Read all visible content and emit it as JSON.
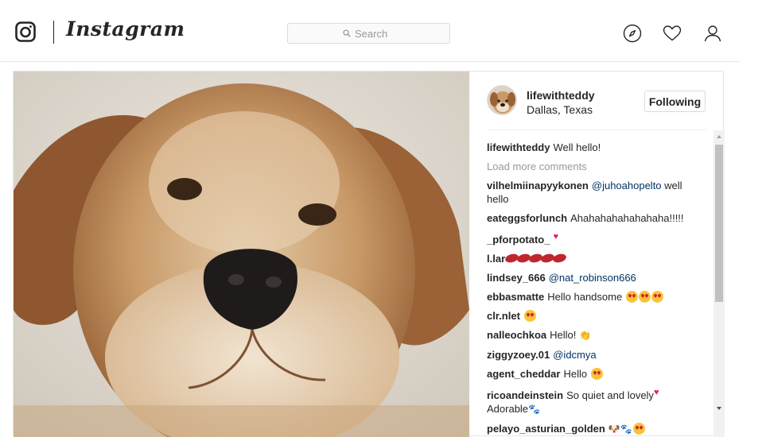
{
  "header": {
    "logo_icon": "camera-icon",
    "wordmark": "Instagram",
    "search_placeholder": "Search",
    "nav": [
      "compass-icon",
      "heart-icon",
      "profile-icon"
    ]
  },
  "post": {
    "photo_alt": "golden retriever close-up",
    "author": {
      "username": "lifewithteddy",
      "location": "Dallas, Texas",
      "follow_label": "Following"
    },
    "caption": {
      "user": "lifewithteddy",
      "text": "Well hello!"
    },
    "load_more": "Load more comments",
    "comments": [
      {
        "user": "vilhelmiinapyykonen",
        "text": "",
        "mention": "@juhoahopelto",
        "after": "well hello",
        "emoji": ""
      },
      {
        "user": "eateggsforlunch",
        "text": "Ahahahahahahahaha!!!!!",
        "mention": "",
        "after": "",
        "emoji": ""
      },
      {
        "user": "_pforpotato_",
        "text": "",
        "mention": "",
        "after": "",
        "emoji": "heart"
      },
      {
        "user": "l.lar",
        "text": "",
        "mention": "",
        "after": "",
        "emoji": "lips"
      },
      {
        "user": "lindsey_666",
        "text": "",
        "mention": "@nat_robinson666",
        "after": "",
        "emoji": ""
      },
      {
        "user": "ebbasmatte",
        "text": "Hello handsome",
        "mention": "",
        "after": "",
        "emoji": "heart-eyes x3"
      },
      {
        "user": "clr.nlet",
        "text": "",
        "mention": "",
        "after": "",
        "emoji": "face"
      },
      {
        "user": "nalleochkoa",
        "text": "Hello!",
        "mention": "",
        "after": "",
        "emoji": "clap"
      },
      {
        "user": "ziggyzoey.01",
        "text": "",
        "mention": "@idcmya",
        "after": "",
        "emoji": ""
      },
      {
        "user": "agent_cheddar",
        "text": "Hello",
        "mention": "",
        "after": "",
        "emoji": "heart-eyes"
      },
      {
        "user": "ricoandeinstein",
        "text": "So quiet and lovely",
        "mention": "",
        "after": "Adorable",
        "emoji": "heart, paw"
      },
      {
        "user": "pelayo_asturian_golden",
        "text": "",
        "mention": "",
        "after": "",
        "emoji": "dog, paw, heart-eyes"
      }
    ]
  },
  "colors": {
    "text": "#262626",
    "muted": "#999999",
    "mention": "#003569",
    "border": "#dbdbdb"
  }
}
